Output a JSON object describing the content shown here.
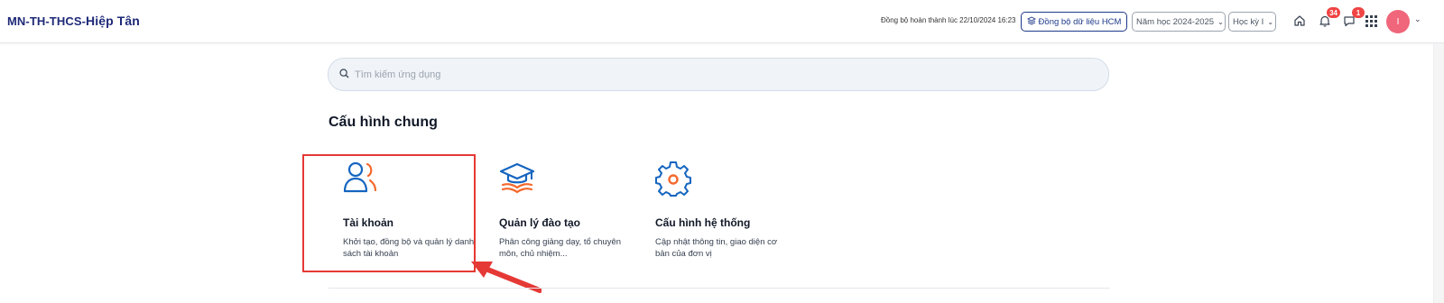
{
  "header": {
    "brand_prefix": "MN-TH-THCS-",
    "brand_name": "Hiệp Tân",
    "sync_status": "Đồng bộ hoàn thành lúc 22/10/2024 16:23",
    "sync_button_label": "Đồng bộ dữ liệu HCM",
    "school_year": "Năm học 2024-2025",
    "term": "Học kỳ I",
    "notifications_count": "34",
    "messages_count": "1",
    "avatar_initial": "I"
  },
  "search": {
    "placeholder": "Tìm kiếm ứng dụng"
  },
  "section": {
    "title": "Cấu hình chung"
  },
  "cards": [
    {
      "icon": "user-accounts-icon",
      "title": "Tài khoản",
      "description": "Khởi tạo, đồng bộ và quản lý danh sách tài khoản"
    },
    {
      "icon": "graduation-cap-icon",
      "title": "Quản lý đào tạo",
      "description": "Phân công giảng dạy, tổ chuyên môn, chủ nhiệm..."
    },
    {
      "icon": "gear-icon",
      "title": "Cấu hình hệ thống",
      "description": "Cập nhật thông tin, giao diện cơ bản của đơn vị"
    }
  ],
  "colors": {
    "brand": "#1e2a78",
    "icon_blue": "#1565c0",
    "icon_orange": "#f4682c",
    "highlight_red": "#e53935",
    "avatar": "#f0667a",
    "badge": "#ef4444"
  }
}
